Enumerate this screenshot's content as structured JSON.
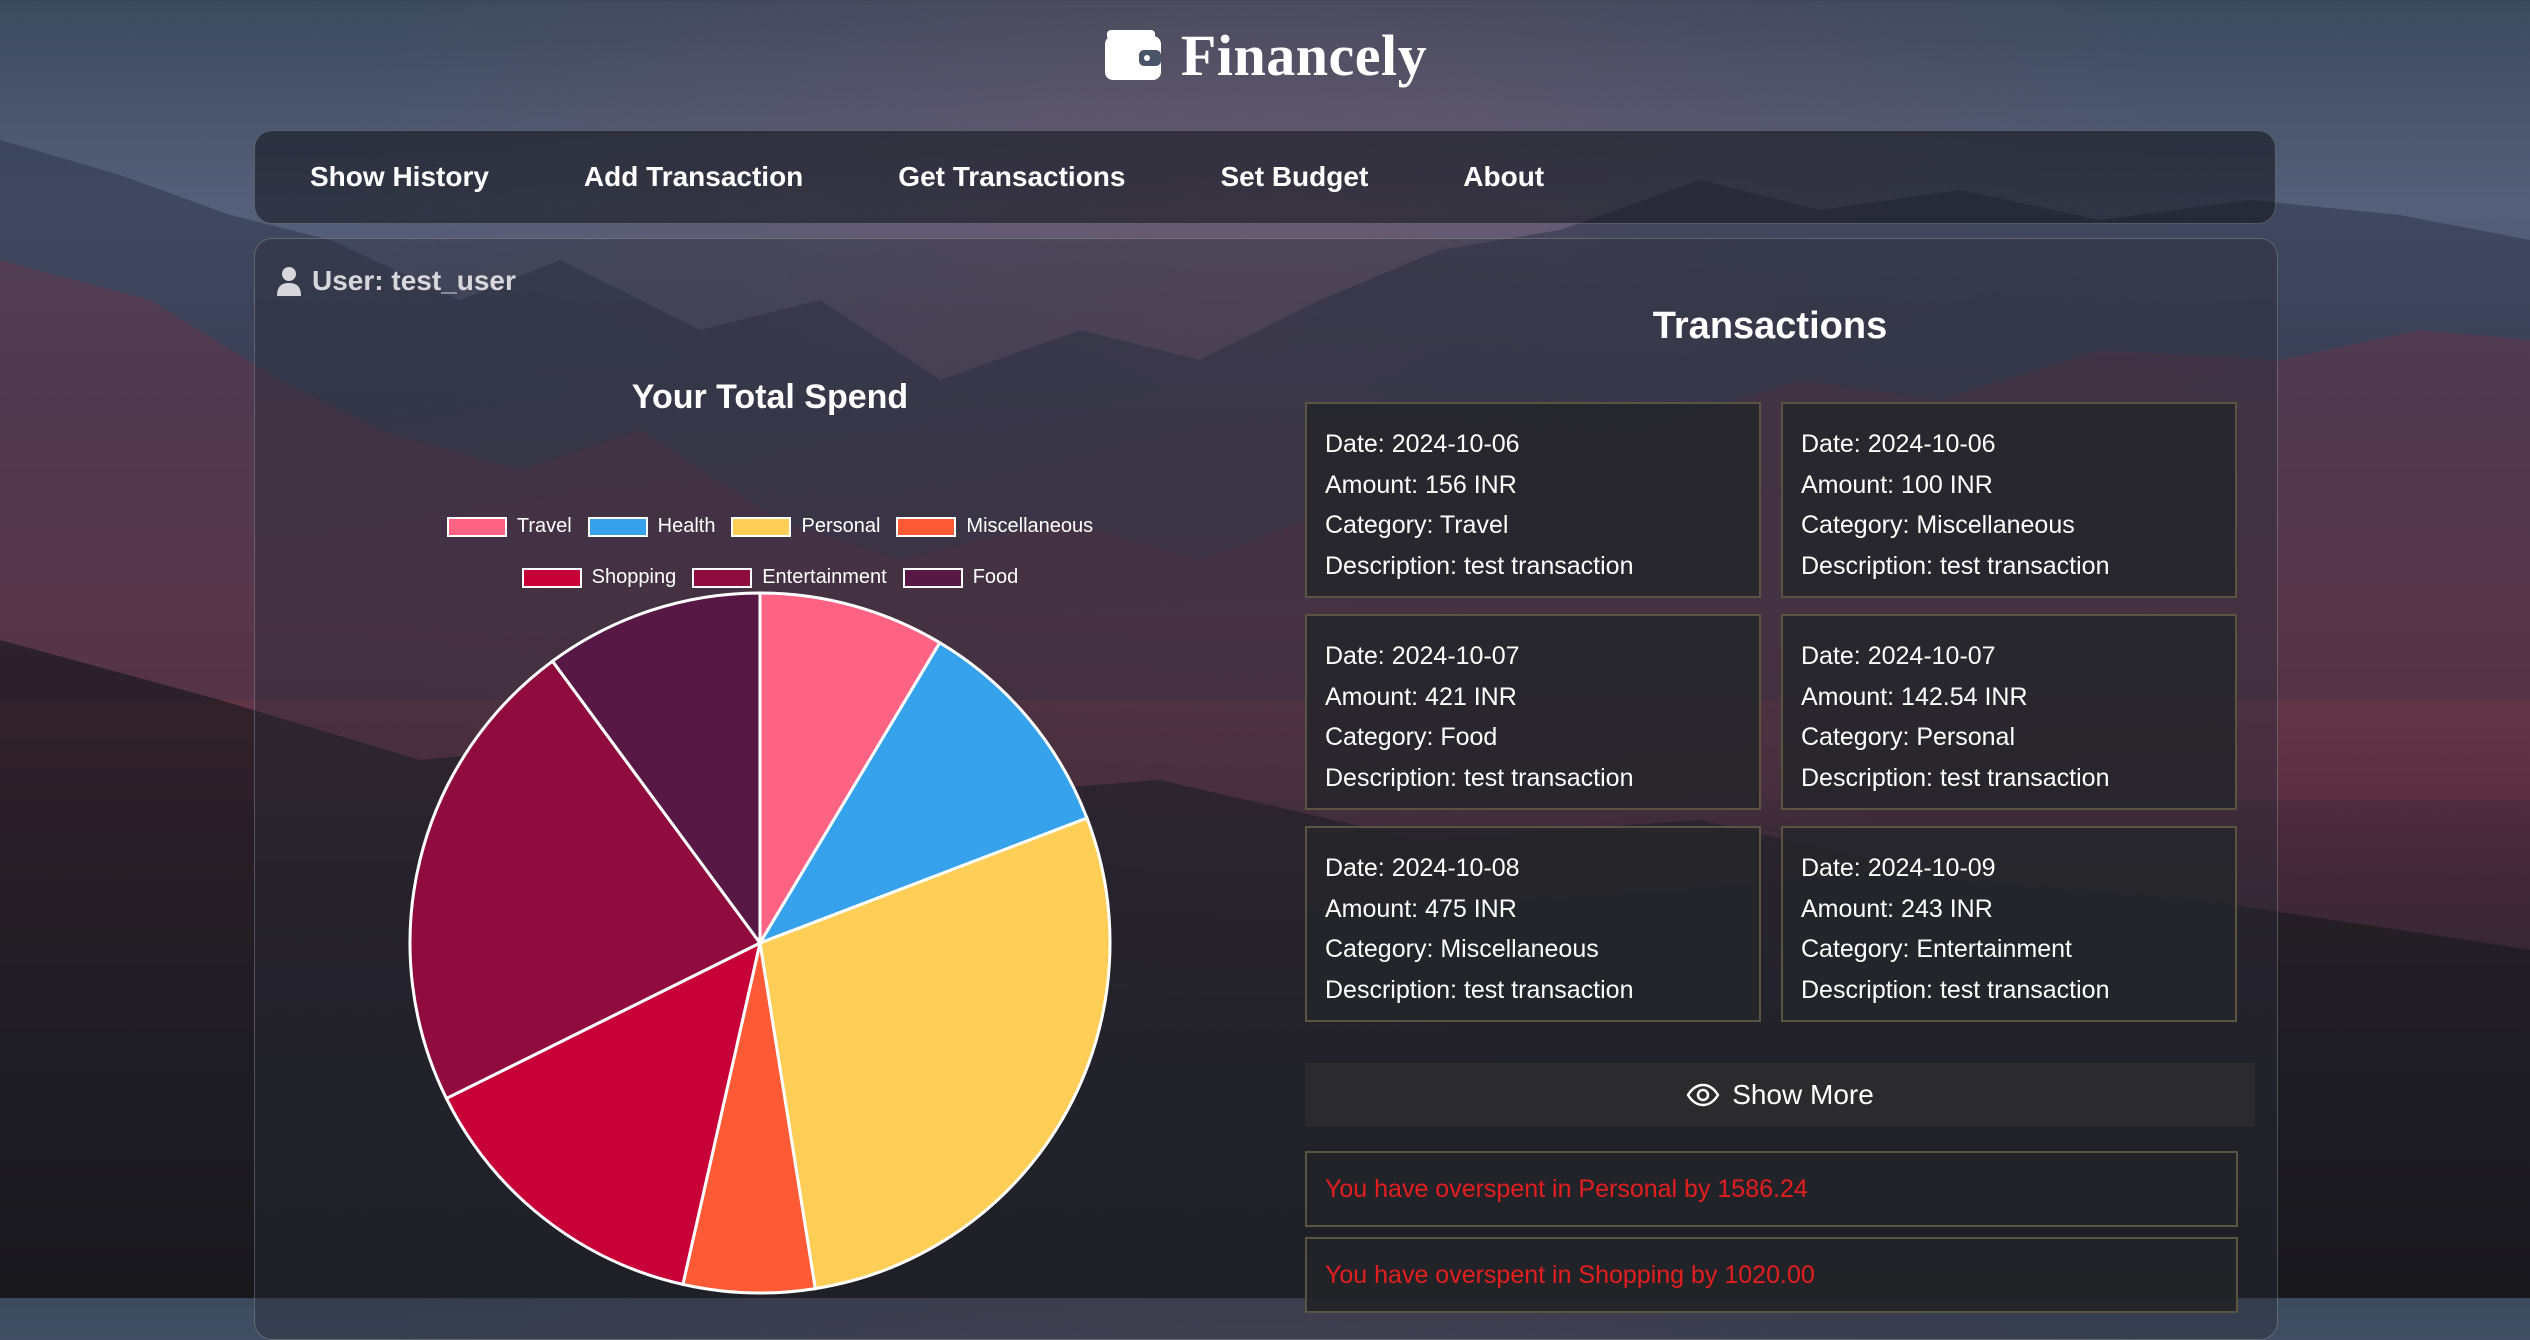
{
  "header": {
    "brand": "Financely",
    "logo_icon": "wallet-icon"
  },
  "nav": {
    "items": [
      {
        "label": "Show History"
      },
      {
        "label": "Add Transaction"
      },
      {
        "label": "Get Transactions"
      },
      {
        "label": "Set Budget"
      },
      {
        "label": "About"
      }
    ]
  },
  "user": {
    "label": "User: test_user",
    "icon": "user-icon"
  },
  "spend": {
    "title": "Your Total Spend"
  },
  "chart_data": {
    "type": "pie",
    "title": "Your Total Spend",
    "legend_position": "top",
    "categories": [
      "Travel",
      "Health",
      "Personal",
      "Miscellaneous",
      "Shopping",
      "Entertainment",
      "Food"
    ],
    "values": [
      8.5,
      10.5,
      28,
      6,
      14,
      22,
      10
    ],
    "colors": [
      "#ff6384",
      "#36a2eb",
      "#ffce56",
      "#ff5a36",
      "#c70039",
      "#900c3f",
      "#581845"
    ]
  },
  "transactions": {
    "title": "Transactions",
    "items": [
      {
        "date": "Date: 2024-10-06",
        "amount": "Amount: 156 INR",
        "category": "Category: Travel",
        "description": "Description: test transaction"
      },
      {
        "date": "Date: 2024-10-06",
        "amount": "Amount: 100 INR",
        "category": "Category: Miscellaneous",
        "description": "Description: test transaction"
      },
      {
        "date": "Date: 2024-10-07",
        "amount": "Amount: 421 INR",
        "category": "Category: Food",
        "description": "Description: test transaction"
      },
      {
        "date": "Date: 2024-10-07",
        "amount": "Amount: 142.54 INR",
        "category": "Category: Personal",
        "description": "Description: test transaction"
      },
      {
        "date": "Date: 2024-10-08",
        "amount": "Amount: 475 INR",
        "category": "Category: Miscellaneous",
        "description": "Description: test transaction"
      },
      {
        "date": "Date: 2024-10-09",
        "amount": "Amount: 243 INR",
        "category": "Category: Entertainment",
        "description": "Description: test transaction"
      }
    ],
    "show_more_label": "Show More",
    "show_more_icon": "eye-icon"
  },
  "alerts": [
    "You have overspent in Personal by 1586.24",
    "You have overspent in Shopping by 1020.00"
  ],
  "colors": {
    "alert_text": "#e41e1e",
    "card_border": "#5a5440"
  }
}
